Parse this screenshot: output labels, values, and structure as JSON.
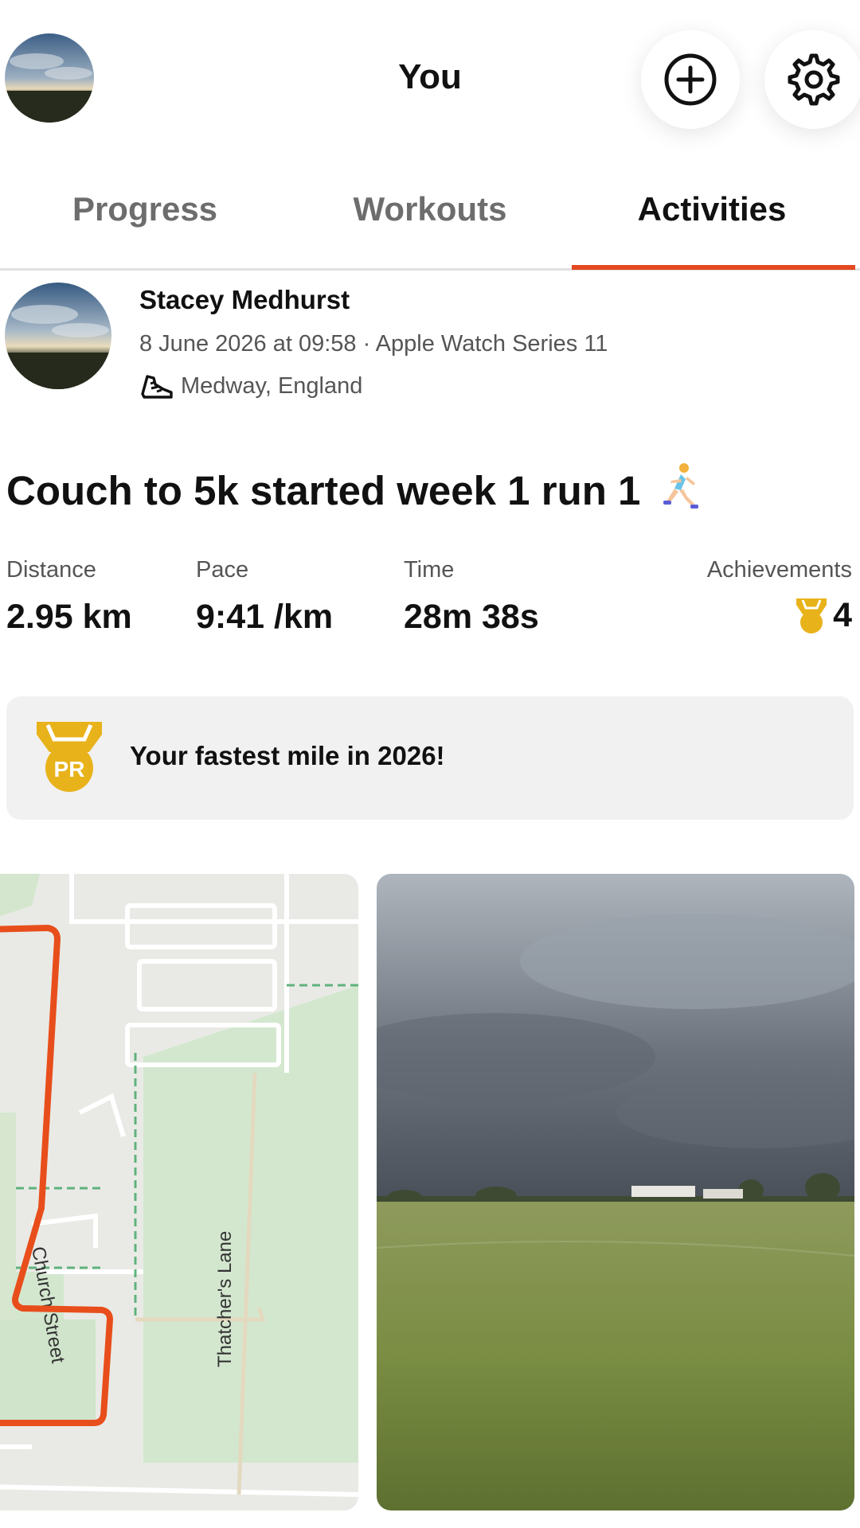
{
  "header": {
    "title": "You",
    "add_icon": "plus-circle-icon",
    "settings_icon": "gear-icon"
  },
  "tabs": [
    {
      "label": "Progress",
      "active": false
    },
    {
      "label": "Workouts",
      "active": false
    },
    {
      "label": "Activities",
      "active": true
    }
  ],
  "activity": {
    "author": "Stacey Medhurst",
    "meta": "8 June 2026 at 09:58 · Apple Watch Series 11",
    "location": "Medway, England",
    "title": "Couch to 5k started week 1 run 1",
    "stats": [
      {
        "label": "Distance",
        "value": "2.95 km"
      },
      {
        "label": "Pace",
        "value": "9:41 /km"
      },
      {
        "label": "Time",
        "value": "28m 38s"
      }
    ],
    "achievements": {
      "label": "Achievements",
      "count": "4"
    },
    "pr_banner": {
      "badge": "PR",
      "text": "Your fastest mile in 2026!"
    },
    "map": {
      "street_label_1": "Thatcher's Lane",
      "street_label_2": "Church Street"
    }
  },
  "colors": {
    "accent": "#e4491f",
    "gold": "#e8b21a",
    "route": "#e84e1b"
  }
}
